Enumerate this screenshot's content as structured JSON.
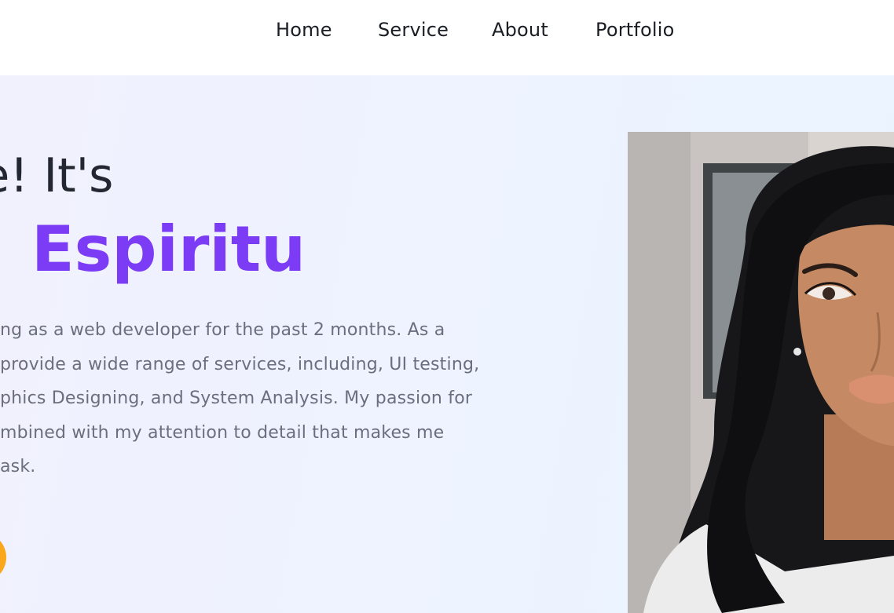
{
  "nav": {
    "items": [
      {
        "label": "Home"
      },
      {
        "label": "Service"
      },
      {
        "label": "About"
      },
      {
        "label": "Portfolio"
      }
    ]
  },
  "hero": {
    "greeting": "re! It's",
    "name": "Espiritu",
    "bio_lines": [
      "ng as a web developer for the past 2 months. As a",
      "provide a wide range of services, including, UI testing,",
      "phics Designing, and System Analysis. My passion for",
      "mbined with my attention to detail that makes me",
      "ask."
    ]
  },
  "colors": {
    "accent": "#7c3cf6",
    "button": "#fba71b",
    "heading": "#23272f",
    "body_text": "#6b6f7d"
  },
  "icons": {
    "portrait": "profile-photo"
  }
}
